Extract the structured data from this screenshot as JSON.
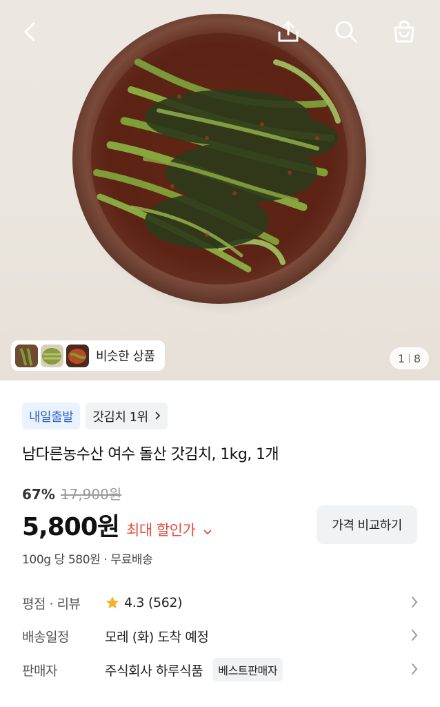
{
  "gallery": {
    "current_page": "1",
    "total_pages": "8",
    "similar_label": "비슷한 상품",
    "icons": [
      "chevron-left-icon",
      "share-icon",
      "search-icon",
      "shopping-bag-icon"
    ]
  },
  "product": {
    "badges": {
      "delivery": "내일출발",
      "rank": "갓김치 1위"
    },
    "title": "남다른농수산 여수 돌산 갓김치, 1kg, 1개",
    "discount_rate": "67%",
    "original_price": "17,900원",
    "price": "5,800원",
    "max_discount_label": "최대 할인가",
    "compare_button": "가격 비교하기",
    "unit_price": "100g 당 580원 · 무료배송"
  },
  "details": {
    "rating": {
      "label": "평점 · 리뷰",
      "score": "4.3",
      "count": "(562)"
    },
    "delivery": {
      "label": "배송일정",
      "value": "모레 (화) 도착 예정"
    },
    "seller": {
      "label": "판매자",
      "value": "주식회사 하루식품",
      "tag": "베스트판매자"
    }
  },
  "colors": {
    "discount_red": "#e24b3b",
    "badge_blue": "#2a65c8",
    "star_yellow": "#f5b323"
  }
}
